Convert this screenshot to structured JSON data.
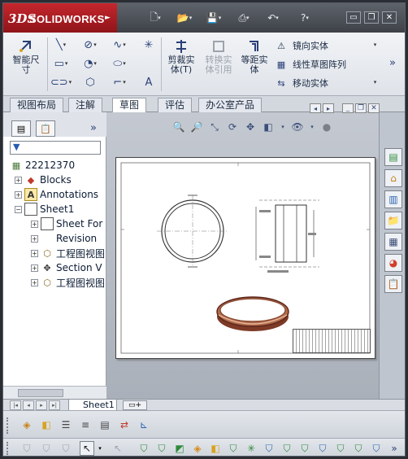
{
  "app": {
    "brand_mark": "3DS",
    "brand_name": "SOLIDWORKS"
  },
  "titlebar": {
    "icons": [
      "new-icon",
      "open-icon",
      "save-icon",
      "print-icon",
      "undo-icon",
      "help-icon"
    ],
    "window_buttons": [
      "minimize",
      "restore",
      "close"
    ]
  },
  "ribbon": {
    "smart_dimension": "智能尺\n寸",
    "trim": "剪裁实\n体(T)",
    "convert": "转换实\n体引用",
    "offset": "等距实\n体",
    "mirror": "镜向实体",
    "linear_pattern": "线性草图阵列",
    "move": "移动实体"
  },
  "tabs": [
    {
      "label": "视图布局",
      "active": false
    },
    {
      "label": "注解",
      "active": false
    },
    {
      "label": "草图",
      "active": true
    },
    {
      "label": "评估",
      "active": false
    },
    {
      "label": "办公室产品",
      "active": false
    }
  ],
  "tree": {
    "filter_icon": "funnel-icon",
    "items": [
      {
        "label": "22212370",
        "icon": "drawing-icon"
      },
      {
        "label": "Blocks",
        "icon": "blocks-icon"
      },
      {
        "label": "Annotations",
        "icon": "annotations-icon"
      },
      {
        "label": "Sheet1",
        "icon": "sheet-icon"
      },
      {
        "label": "Sheet For",
        "icon": "sheet-format-icon"
      },
      {
        "label": "Revision",
        "icon": "revision-icon"
      },
      {
        "label": "工程图视图",
        "icon": "drawing-view-icon"
      },
      {
        "label": "Section V",
        "icon": "section-view-icon"
      },
      {
        "label": "工程图视图",
        "icon": "drawing-view-icon"
      }
    ]
  },
  "sheet_tab": {
    "label": "Sheet1"
  },
  "colors": {
    "brand_red": "#c4272d",
    "ring_copper": "#b06a4a",
    "graphics_bg": "#b8bec7"
  }
}
